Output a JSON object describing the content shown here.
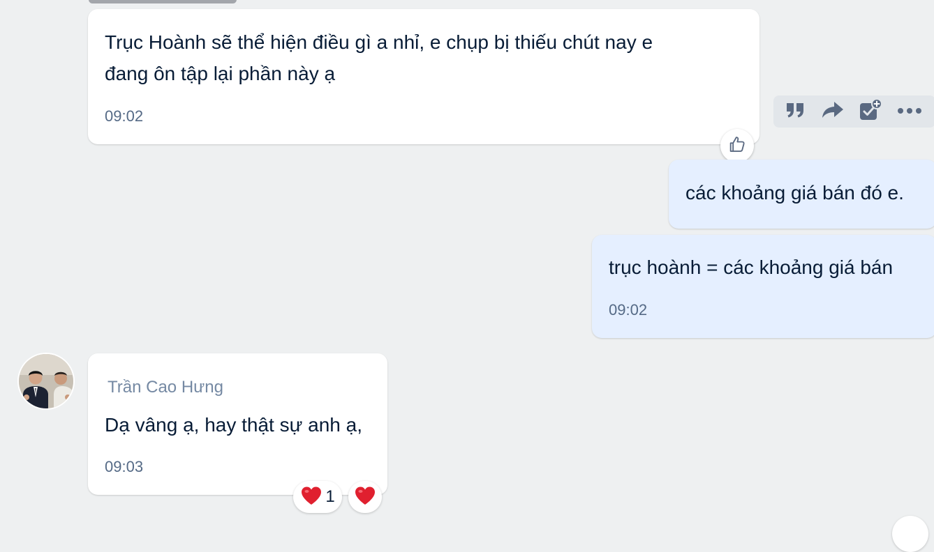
{
  "messages": [
    {
      "direction": "incoming",
      "lines": [
        "Trục Hoành sẽ thể hiện điều gì a nhỉ, e chụp bị thiếu chút nay e",
        "đang ôn tập lại phần này ạ"
      ],
      "time": "09:02"
    },
    {
      "direction": "outgoing",
      "lines": [
        "các khoảng giá bán đó e."
      ]
    },
    {
      "direction": "outgoing",
      "lines": [
        "trục hoành = các khoảng giá bán"
      ],
      "time": "09:02"
    },
    {
      "direction": "incoming",
      "sender": "Trần Cao Hưng",
      "lines": [
        "Dạ vâng ạ, hay thật sự anh ạ,"
      ],
      "time": "09:03",
      "reactions": [
        {
          "icon": "heart-icon",
          "count": "1"
        },
        {
          "icon": "heart-icon"
        }
      ]
    }
  ],
  "hover_actions": [
    "quote-icon",
    "forward-icon",
    "add-task-icon",
    "more-icon"
  ],
  "like_icon": "thumbs-up-icon",
  "colors": {
    "background": "#eef0f1",
    "incoming_bubble": "#ffffff",
    "outgoing_bubble": "#e5efff",
    "text": "#081c36",
    "time": "#556a86",
    "sender": "#7589a3",
    "icon": "#5a6981",
    "heart": "#e0202f"
  }
}
